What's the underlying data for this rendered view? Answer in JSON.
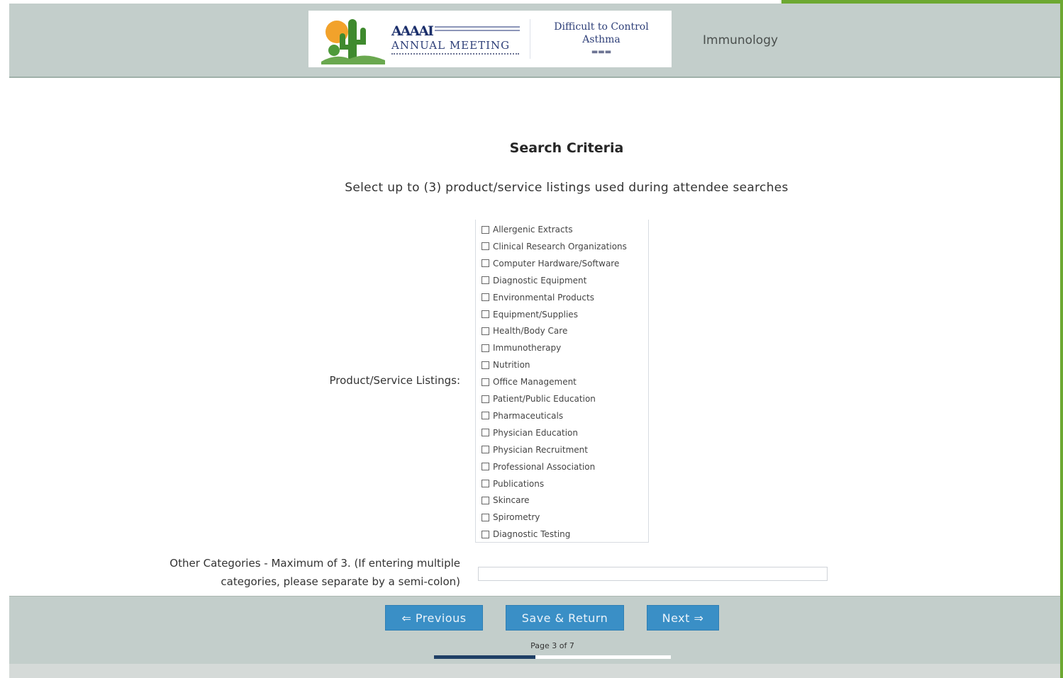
{
  "colors": {
    "header_bg": "#c3cecb",
    "button_bg": "#3a8fc6",
    "progress_fill": "#1f3f66",
    "accent_green": "#6da832"
  },
  "header": {
    "banner": {
      "logo_mark": "AAAAI",
      "logo_title": "ANNUAL MEETING",
      "topic_line1": "Difficult to Control",
      "topic_line2": "Asthma",
      "icon": "cactus-sun-icon"
    },
    "category": "Immunology"
  },
  "main": {
    "title": "Search Criteria",
    "instruction": "Select up to (3) product/service listings used during attendee searches",
    "listings_label": "Product/Service Listings:",
    "listings": [
      "Allergenic Extracts",
      "Clinical Research Organizations",
      "Computer Hardware/Software",
      "Diagnostic Equipment",
      "Environmental Products",
      "Equipment/Supplies",
      "Health/Body Care",
      "Immunotherapy",
      "Nutrition",
      "Office Management",
      "Patient/Public Education",
      "Pharmaceuticals",
      "Physician Education",
      "Physician Recruitment",
      "Professional Association",
      "Publications",
      "Skincare",
      "Spirometry",
      "Diagnostic Testing"
    ],
    "other_label_line1": "Other Categories - Maximum of 3. (If entering multiple",
    "other_label_line2": "categories, please separate by a semi-colon)",
    "other_value": ""
  },
  "footer": {
    "previous_label": "⇐ Previous",
    "save_label": "Save & Return",
    "next_label": "Next ⇒",
    "page_text": "Page 3 of 7",
    "progress_fraction": 0.4286
  }
}
